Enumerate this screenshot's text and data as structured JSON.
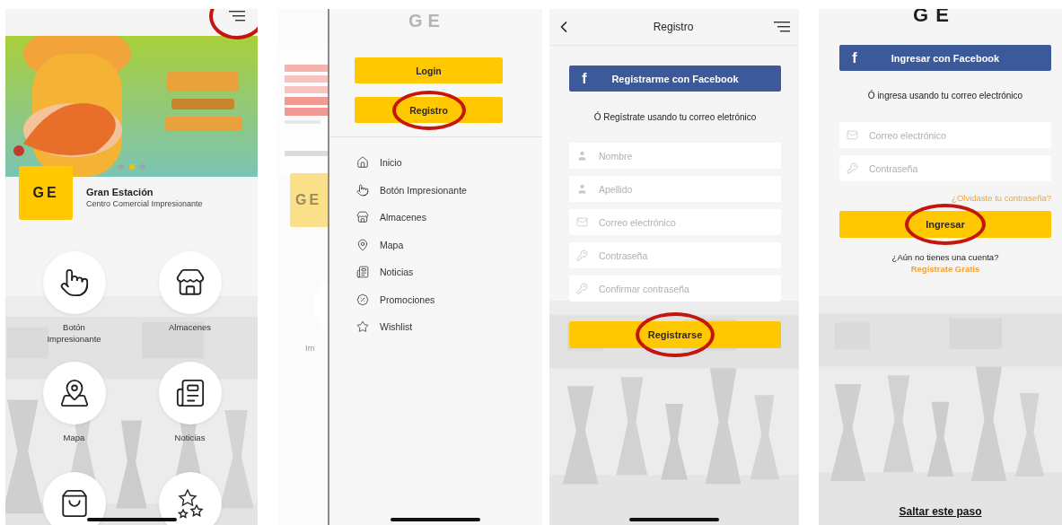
{
  "screens": [
    {
      "kind": "home",
      "menu_button": {
        "circled": true
      },
      "carousel": [
        {
          "selected": false
        },
        {
          "selected": true
        },
        {
          "selected": false
        }
      ],
      "brand": {
        "logo": "GE",
        "title": "Gran Estación",
        "subtitle": "Centro Comercial Impresionante"
      },
      "tiles": [
        {
          "kind": "press",
          "label": "Botón Impresionante"
        },
        {
          "kind": "store",
          "label": "Almacenes"
        },
        {
          "kind": "map",
          "label": "Mapa"
        },
        {
          "kind": "news",
          "label": "Noticias"
        },
        {
          "kind": "bag"
        },
        {
          "kind": "stars"
        }
      ]
    },
    {
      "kind": "drawer",
      "behind": {
        "logo": "GE",
        "cut_label": "Im"
      },
      "logo": "GE",
      "buttons": [
        {
          "label": "Login",
          "circled": false
        },
        {
          "label": "Registro",
          "circled": true
        }
      ],
      "menu": [
        {
          "kind": "home",
          "label": "Inicio"
        },
        {
          "kind": "press",
          "label": "Botón Impresionante"
        },
        {
          "kind": "store",
          "label": "Almacenes"
        },
        {
          "kind": "pin",
          "label": "Mapa"
        },
        {
          "kind": "news",
          "label": "Noticias"
        },
        {
          "kind": "percent",
          "label": "Promociones"
        },
        {
          "kind": "star",
          "label": "Wishlist"
        }
      ]
    },
    {
      "kind": "register",
      "title": "Registro",
      "facebook": {
        "glyph": "f",
        "label": "Registrarme con Facebook"
      },
      "prompt": "Ó Regístrate usando tu correo eletrónico",
      "fields": [
        {
          "kind": "person",
          "placeholder": "Nombre"
        },
        {
          "kind": "person",
          "placeholder": "Apellido"
        },
        {
          "kind": "mail",
          "placeholder": "Correo electrónico"
        },
        {
          "kind": "key",
          "placeholder": "Contraseña"
        },
        {
          "kind": "key",
          "placeholder": "Confirmar contraseña"
        }
      ],
      "submit": {
        "label": "Registrarse",
        "circled": true
      }
    },
    {
      "kind": "login",
      "logo": "GE",
      "facebook": {
        "glyph": "f",
        "label": "Ingresar con Facebook"
      },
      "prompt": "Ó ingresa usando tu correo electrónico",
      "fields": [
        {
          "kind": "mail",
          "placeholder": "Correo electrónico"
        },
        {
          "kind": "key",
          "placeholder": "Contraseña"
        }
      ],
      "forgot": "¿Olvidaste tu contraseña?",
      "submit": {
        "label": "Ingresar",
        "circled": true
      },
      "signup_question": "¿Aún no tienes una cuenta?",
      "signup_link": "Regístrate Gratis",
      "skip": "Saltar este paso"
    }
  ]
}
